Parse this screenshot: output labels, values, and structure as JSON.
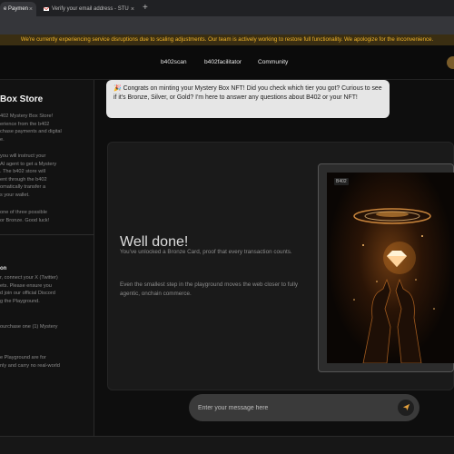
{
  "browser": {
    "tabs": [
      {
        "label": "e Paymen",
        "active": true
      },
      {
        "label": "Verify your email address - STU",
        "active": false
      }
    ],
    "new_tab": "+",
    "close": "×"
  },
  "banner": {
    "text": "We're currently experiencing service disruptions due to scaling adjustments. Our team is actively working to restore full functionality. We apologize for the inconvenience."
  },
  "nav": {
    "links": [
      "b402scan",
      "b402facilitator",
      "Community"
    ]
  },
  "sidebar": {
    "heading": "Box Store",
    "para1": "402 Mystery Box Store!\nerience from the b402\nchase payments and digital\ne.",
    "para2": "you will instruct your\nAI agent to get a Mystery\n. The b402 store will\nent through the b402\nomatically transfer a\ns your wallet.",
    "para3": "one of three possible\nor Bronze. Good luck!",
    "subhead": "on",
    "para4": "r, connect your X (Twitter)\nets. Please ensure you\nd join our official Discord\ng the Playground.",
    "para5": "ourchase one (1) Mystery",
    "para6": "e Playground are for\nnly and carry no real-world"
  },
  "chat": {
    "message": "Congrats on minting your Mystery Box NFT! Did you check which tier you got? Curious to see if it's Bronze, Silver, or Gold? I'm here to answer any questions about B402 or your NFT!"
  },
  "card": {
    "title": "Well done!",
    "text1": "You've unlocked a Bronze Card, proof that every transaction counts.",
    "text2": "Even the smallest step in the playground moves the web closer to fully agentic, onchain commerce.",
    "badge": "B402"
  },
  "input": {
    "placeholder": "Enter your message here"
  },
  "icons": {
    "send": "send-icon"
  },
  "colors": {
    "banner_text": "#f0b429",
    "accent": "#f0b429"
  }
}
